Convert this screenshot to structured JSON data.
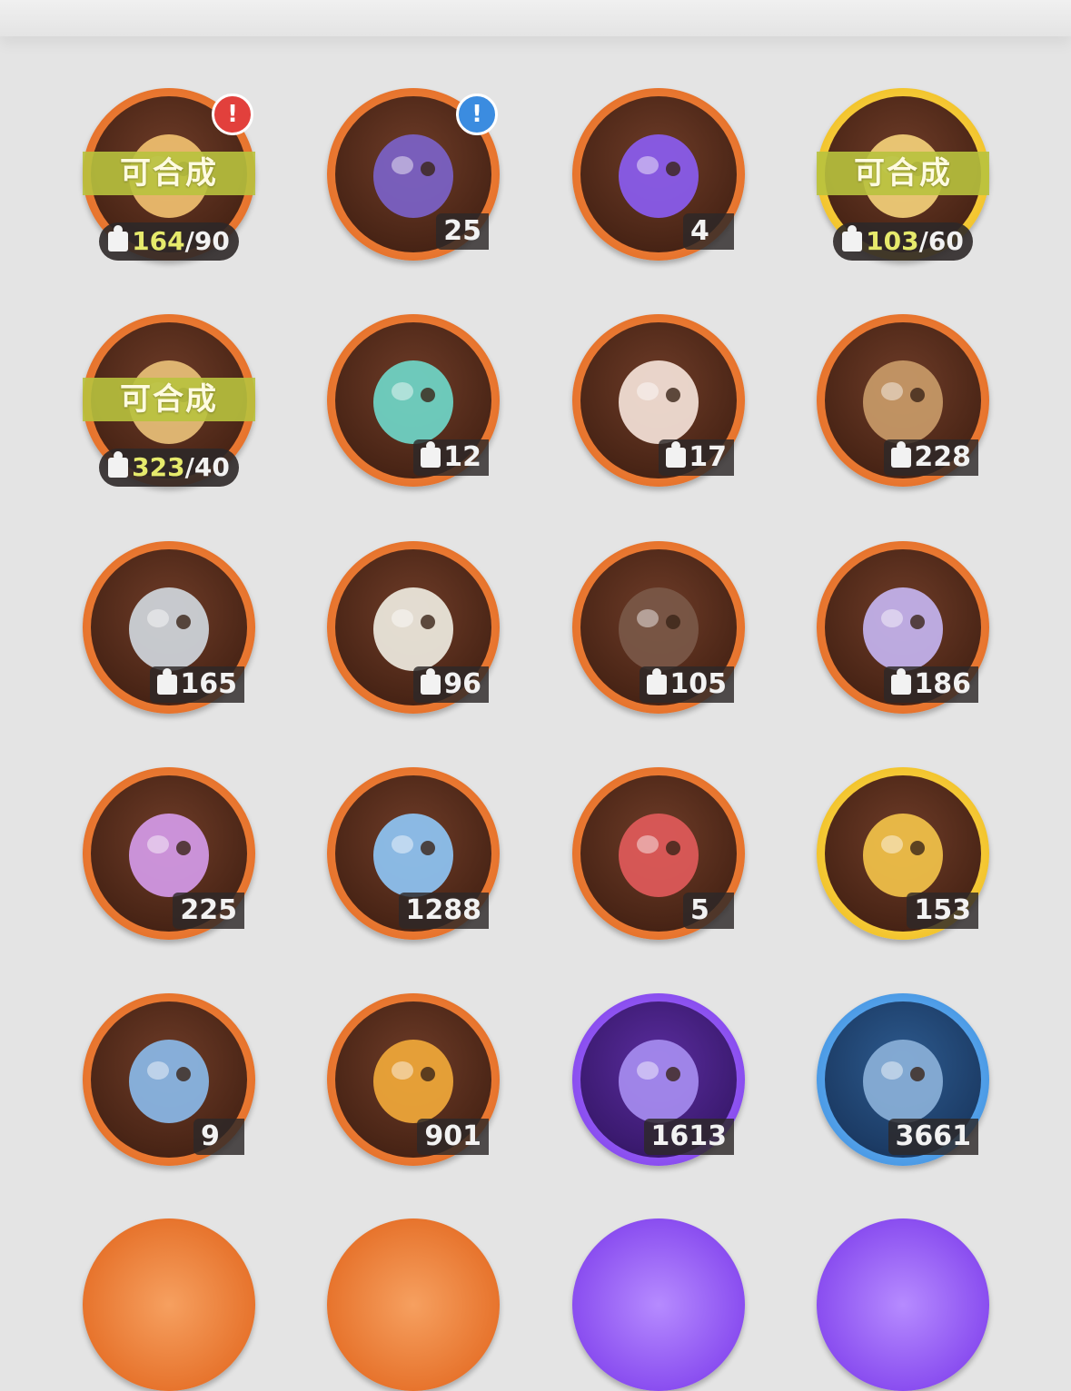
{
  "items": [
    {
      "id": "i1",
      "icon": "hamster-fragment-icon",
      "ring": "orange",
      "art": "#f0c070",
      "craft": {
        "label": "可合成",
        "have": "164",
        "need": "/90"
      },
      "alert": "red"
    },
    {
      "id": "i2",
      "icon": "treasure-chest-icon",
      "ring": "orange",
      "art": "#7b62c8",
      "count": "25",
      "alert": "blue"
    },
    {
      "id": "i3",
      "icon": "purple-crystal-icon",
      "ring": "orange",
      "art": "#8a5cf0",
      "count": "4"
    },
    {
      "id": "i4",
      "icon": "hamster-fragment-icon",
      "ring": "gold",
      "art": "#f3d07a",
      "craft": {
        "label": "可合成",
        "have": "103",
        "need": "/60"
      }
    },
    {
      "id": "i5",
      "icon": "hamster-fragment-icon",
      "ring": "orange",
      "art": "#e8c078",
      "craft": {
        "label": "可合成",
        "have": "323",
        "need": "/40"
      }
    },
    {
      "id": "i6",
      "icon": "teal-bird-icon",
      "ring": "orange",
      "art": "#6fd6c8",
      "frag": "12"
    },
    {
      "id": "i7",
      "icon": "fire-fox-icon",
      "ring": "orange",
      "art": "#f4e2d8",
      "frag": "17"
    },
    {
      "id": "i8",
      "icon": "brown-bear-icon",
      "ring": "orange",
      "art": "#c89a68",
      "frag": "228"
    },
    {
      "id": "i9",
      "icon": "knight-cat-icon",
      "ring": "orange",
      "art": "#cfd6dc",
      "frag": "165"
    },
    {
      "id": "i10",
      "icon": "white-sheep-icon",
      "ring": "orange",
      "art": "#eeeae0",
      "frag": "96"
    },
    {
      "id": "i11",
      "icon": "dark-cat-icon",
      "ring": "orange",
      "art": "#7a5848",
      "frag": "105"
    },
    {
      "id": "i12",
      "icon": "purple-tiger-icon",
      "ring": "orange",
      "art": "#c4b4f0",
      "frag": "186"
    },
    {
      "id": "i13",
      "icon": "pink-star-crystal-icon",
      "ring": "orange",
      "art": "#d49ae8",
      "count": "225"
    },
    {
      "id": "i14",
      "icon": "blue-star-crystal-icon",
      "ring": "orange",
      "art": "#8ec4f4",
      "count": "1288"
    },
    {
      "id": "i15",
      "icon": "paw-charm-icon",
      "ring": "orange",
      "art": "#e05a5a",
      "count": "5"
    },
    {
      "id": "i16",
      "icon": "gold-card-icon",
      "ring": "gold",
      "art": "#f2c24a",
      "count": "153"
    },
    {
      "id": "i17",
      "icon": "rainbow-card-icon",
      "ring": "orange",
      "art": "#8ab8e8",
      "count": "9"
    },
    {
      "id": "i18",
      "icon": "orange-card-icon",
      "ring": "orange",
      "art": "#f0a83a",
      "count": "901"
    },
    {
      "id": "i19",
      "icon": "purple-card-icon",
      "ring": "purple",
      "art": "#a68cf0",
      "count": "1613"
    },
    {
      "id": "i20",
      "icon": "blue-card-icon",
      "ring": "blue",
      "art": "#8ab0d8",
      "count": "3661"
    }
  ],
  "partial_row": [
    {
      "ring": "orange"
    },
    {
      "ring": "orange"
    },
    {
      "ring": "purple"
    },
    {
      "ring": "purple"
    }
  ]
}
